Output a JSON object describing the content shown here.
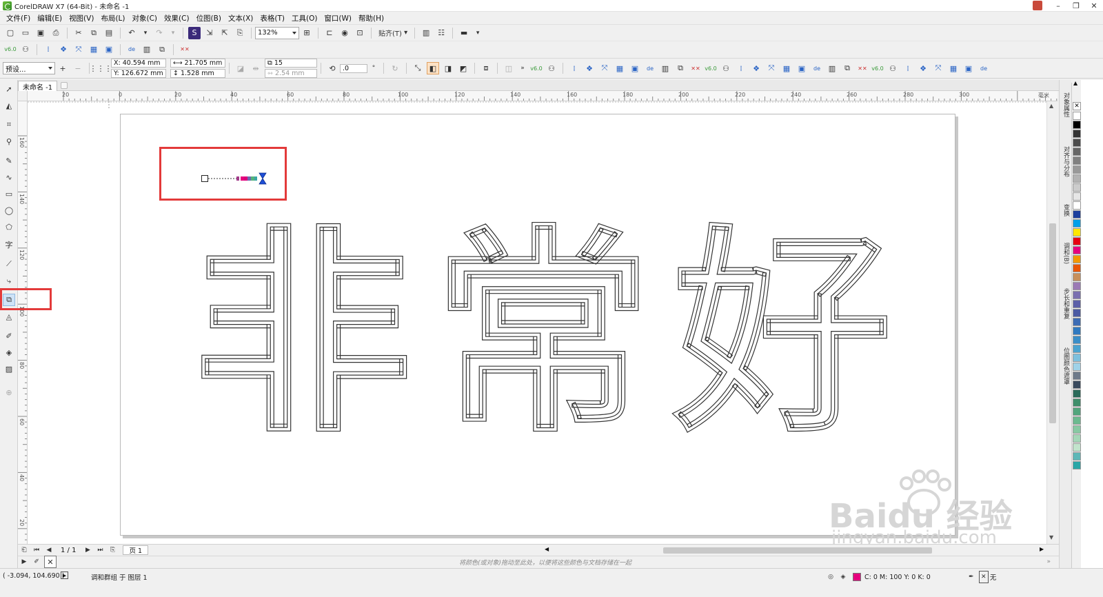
{
  "window": {
    "title": "CorelDRAW X7 (64-Bit) - 未命名 -1",
    "minimize": "–",
    "restore": "❐",
    "close": "✕"
  },
  "menu": [
    "文件(F)",
    "编辑(E)",
    "视图(V)",
    "布局(L)",
    "对象(C)",
    "效果(C)",
    "位图(B)",
    "文本(X)",
    "表格(T)",
    "工具(O)",
    "窗口(W)",
    "帮助(H)"
  ],
  "standard_toolbar": {
    "zoom": "132%",
    "snap_label": "贴齐(T)"
  },
  "property_bar": {
    "preset": "预设...",
    "x": "X: 40.594 mm",
    "y": "Y: 126.672 mm",
    "width": "21.705 mm",
    "height": "1.528 mm",
    "steps": "15",
    "spacing": "2.54 mm",
    "angle": ".0",
    "angle_unit": "°",
    "version_tag": "v6.0"
  },
  "document_tab": "未命名 -1",
  "rulers": {
    "h_labels": [
      "20",
      "0",
      "20",
      "40",
      "60",
      "80",
      "100",
      "120",
      "140",
      "160",
      "180",
      "200",
      "220",
      "240",
      "260",
      "280",
      "300"
    ],
    "h_unit": "毫米",
    "v_labels": [
      "160",
      "140",
      "120",
      "100",
      "80",
      "60",
      "40",
      "20",
      "0"
    ]
  },
  "canvas": {
    "artwork_text": "非常好"
  },
  "page_nav": {
    "counter": "1 / 1",
    "page_tab": "页 1"
  },
  "palette_hint": "将颜色(或对象)拖动至此处，以便将这些颜色与文档存储在一起",
  "status": {
    "coords": "( -3.094, 104.690 )",
    "info": "调和群组 于 图层 1",
    "fill": "C: 0 M: 100 Y: 0 K: 0",
    "outline": "无"
  },
  "dockers": [
    "对象属性",
    "对齐与分布",
    "变换",
    "调和(B)",
    "步长和重复",
    "位图颜色遮罩"
  ],
  "palette_colors": [
    "#ffffff",
    "#000000",
    "#333333",
    "#4d4d4d",
    "#666666",
    "#808080",
    "#999999",
    "#b3b3b3",
    "#cccccc",
    "#e6e6e6",
    "#ffffff",
    "#1d3f9e",
    "#00a0e9",
    "#ffe600",
    "#e60012",
    "#e6007e",
    "#f39800",
    "#ea5504",
    "#c78f5b",
    "#9b7ab5",
    "#7a6fb0",
    "#5d60a8",
    "#4b5aa3",
    "#3c6bb4",
    "#2f79c0",
    "#3a8ec8",
    "#4aa3d0",
    "#7cc0de",
    "#9fd2e8",
    "#6e7a8a",
    "#3a4a5e",
    "#2b6b5a",
    "#3e8e6a",
    "#52a57c",
    "#6cba8f",
    "#88c9a3",
    "#a5d7b8",
    "#c2e4cc",
    "#5eb7b7",
    "#2aa6a6"
  ],
  "watermark": {
    "brand": "Baidu 经验",
    "url": "jingyan.baidu.com"
  }
}
